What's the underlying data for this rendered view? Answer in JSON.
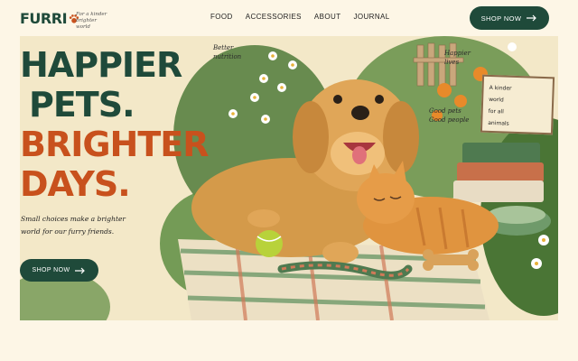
{
  "brand": {
    "name": "FURRI",
    "tagline": "For a kinder brighter world"
  },
  "nav": {
    "items": [
      "FOOD",
      "ACCESSORIES",
      "ABOUT",
      "JOURNAL"
    ]
  },
  "header": {
    "cta_label": "SHOP NOW"
  },
  "hero": {
    "headline": {
      "line1": "HAPPIER",
      "line2": "PETS.",
      "line3": "BRIGHTER",
      "line4": "DAYS."
    },
    "subcopy": "Small choices make a brighter world for our furry friends.",
    "cta_label": "SHOP NOW",
    "notes": {
      "better_nutrition": "Better nutrition",
      "happier_lives": "Happier lives",
      "good_pets": "Good pets Good people"
    },
    "sign": {
      "line1": "A kinder",
      "line2": "world",
      "line3": "for all",
      "line4": "animals"
    }
  },
  "colors": {
    "brand_green": "#1f4a3a",
    "accent_orange": "#c8511d",
    "background": "#fdf6e6"
  }
}
